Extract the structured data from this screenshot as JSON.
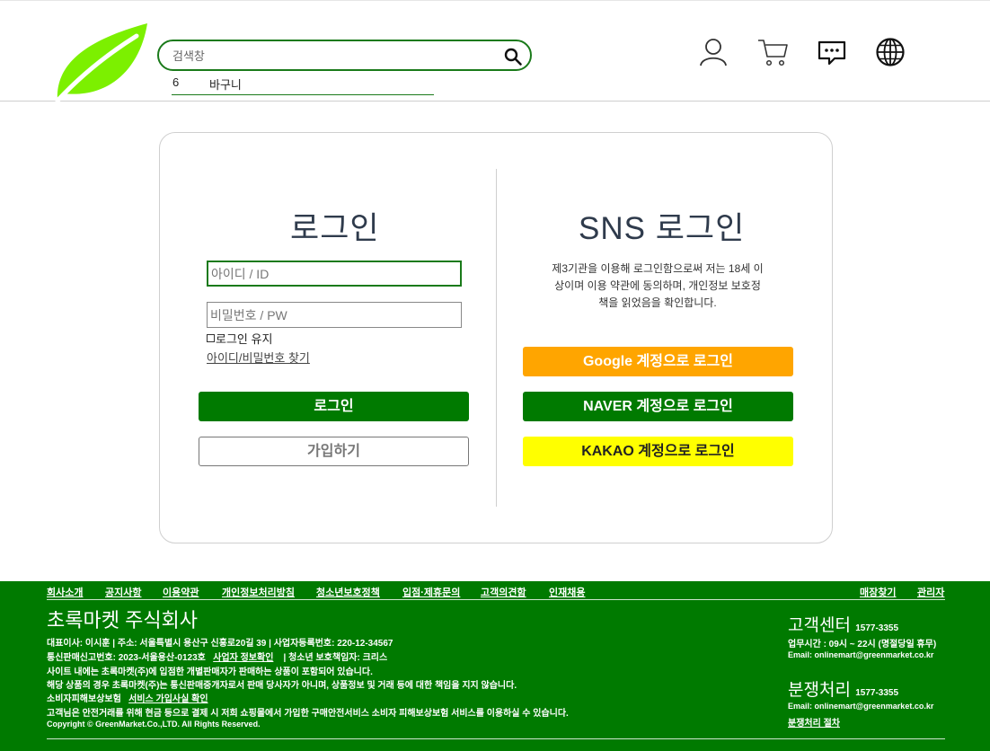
{
  "header": {
    "search": {
      "placeholder": "검색창"
    },
    "autocomplete": {
      "count": "6",
      "text": "바구니"
    },
    "icons": [
      "user-icon",
      "cart-icon",
      "chat-icon",
      "globe-icon"
    ]
  },
  "login": {
    "title": "로그인",
    "id_placeholder": "아이디 / ID",
    "pw_placeholder": "비밀번호 / PW",
    "remember_label": "로그인 유지",
    "find_link": "아이디/비밀번호 찾기",
    "login_button": "로그인",
    "join_button": "가입하기"
  },
  "sns": {
    "title": "SNS 로그인",
    "desc_lines": [
      "제3기관을 이용해 로그인함으로써 저는 18세 이",
      "상이며 이용 약관에 동의하며, 개인정보 보호정",
      "책을 읽었음을 확인합니다."
    ],
    "google_button": "Google 계정으로 로그인",
    "naver_button": "NAVER 계정으로 로그인",
    "kakao_button": "KAKAO 계정으로 로그인"
  },
  "footer": {
    "nav": [
      "회사소개",
      "공지사항",
      "이용약관",
      "개인정보처리방침",
      "청소년보호정책",
      "입점·제휴문의",
      "고객의견함",
      "인재채용"
    ],
    "nav_right": [
      "매장찾기",
      "관리자"
    ],
    "company": "초록마켓 주식회사",
    "line1": "대표이사: 이시훈   |   주소: 서울특별시 용산구 신흥로20길 39   |   사업자등록번호: 220-12-34567",
    "line2_a": "통신판매신고번호: 2023-서울용산-0123호",
    "line2_link": "사업자 정보확인",
    "line2_b": "|   청소년 보호책임자: 크리스",
    "line3": "사이트 내에는 초록마켓(주)에 입점한 개별판매자가 판매하는 상품이 포함되어 있습니다.",
    "line4": "해당 상품의 경우 초록마켓(주)는 통신판매중개자로서 판매 당사자가 아니며, 상품정보 및 거래 등에 대한 책임을 지지 않습니다.",
    "line5_a": "소비자피해보상보험",
    "line5_link": "서비스 가입사실 확인",
    "line6": "고객님은 안전거래를 위해 현금 등으로 결제 시 저희 쇼핑몰에서 가입한 구매안전서비스 소비자 피해보상보험 서비스를 이용하실 수 있습니다.",
    "copyright": "Copyright © GreenMarket.Co.,LTD. All Rights Reserved.",
    "cs_title": "고객센터",
    "cs_phone": "1577-3355",
    "cs_hours": "업무시간 : 09시 ~ 22시 (명절당일 휴무)",
    "cs_email": "Email: onlinemart@greenmarket.co.kr",
    "dispute_title": "분쟁처리",
    "dispute_phone": "1577-3355",
    "dispute_email": "Email: onlinemart@greenmarket.co.kr",
    "dispute_link": "분쟁처리 절차"
  },
  "colors": {
    "brand_green": "#007a00",
    "google": "#ffa500",
    "kakao": "#ffff00",
    "logo_green": "#7cf000"
  }
}
